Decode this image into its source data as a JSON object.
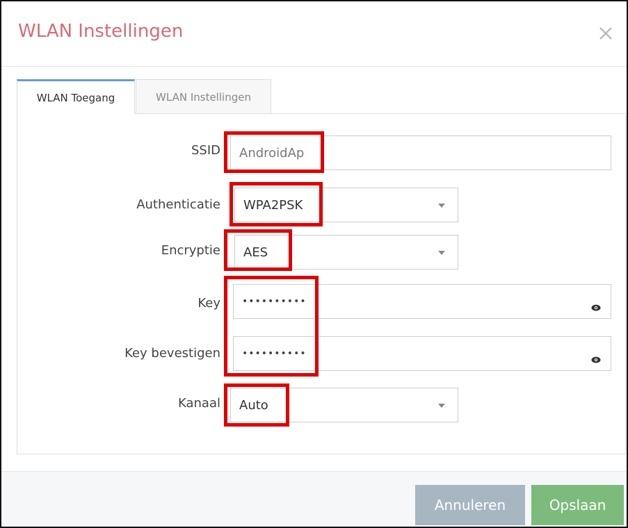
{
  "dialog": {
    "title": "WLAN Instellingen",
    "close_symbol": "×"
  },
  "tabs": [
    {
      "label": "WLAN Toegang",
      "active": true
    },
    {
      "label": "WLAN Instellingen",
      "active": false
    }
  ],
  "form": {
    "ssid": {
      "label": "SSID",
      "value": "AndroidAp"
    },
    "auth": {
      "label": "Authenticatie",
      "value": "WPA2PSK"
    },
    "enc": {
      "label": "Encryptie",
      "value": "AES"
    },
    "key": {
      "label": "Key",
      "value": "••••••••••"
    },
    "key_confirm": {
      "label": "Key bevestigen",
      "value": "••••••••••"
    },
    "channel": {
      "label": "Kanaal",
      "value": "Auto"
    }
  },
  "footer": {
    "cancel_label": "Annuleren",
    "save_label": "Opslaan"
  },
  "icons": {
    "close": "close-icon",
    "dropdown": "chevron-down-icon",
    "reveal": "eye-icon"
  },
  "colors": {
    "title": "#d96b72",
    "tab_active_border": "#6b9bcd",
    "highlight": "#e00000",
    "cancel_button": "#a7b6c1",
    "save_button": "#7cbb7c"
  }
}
